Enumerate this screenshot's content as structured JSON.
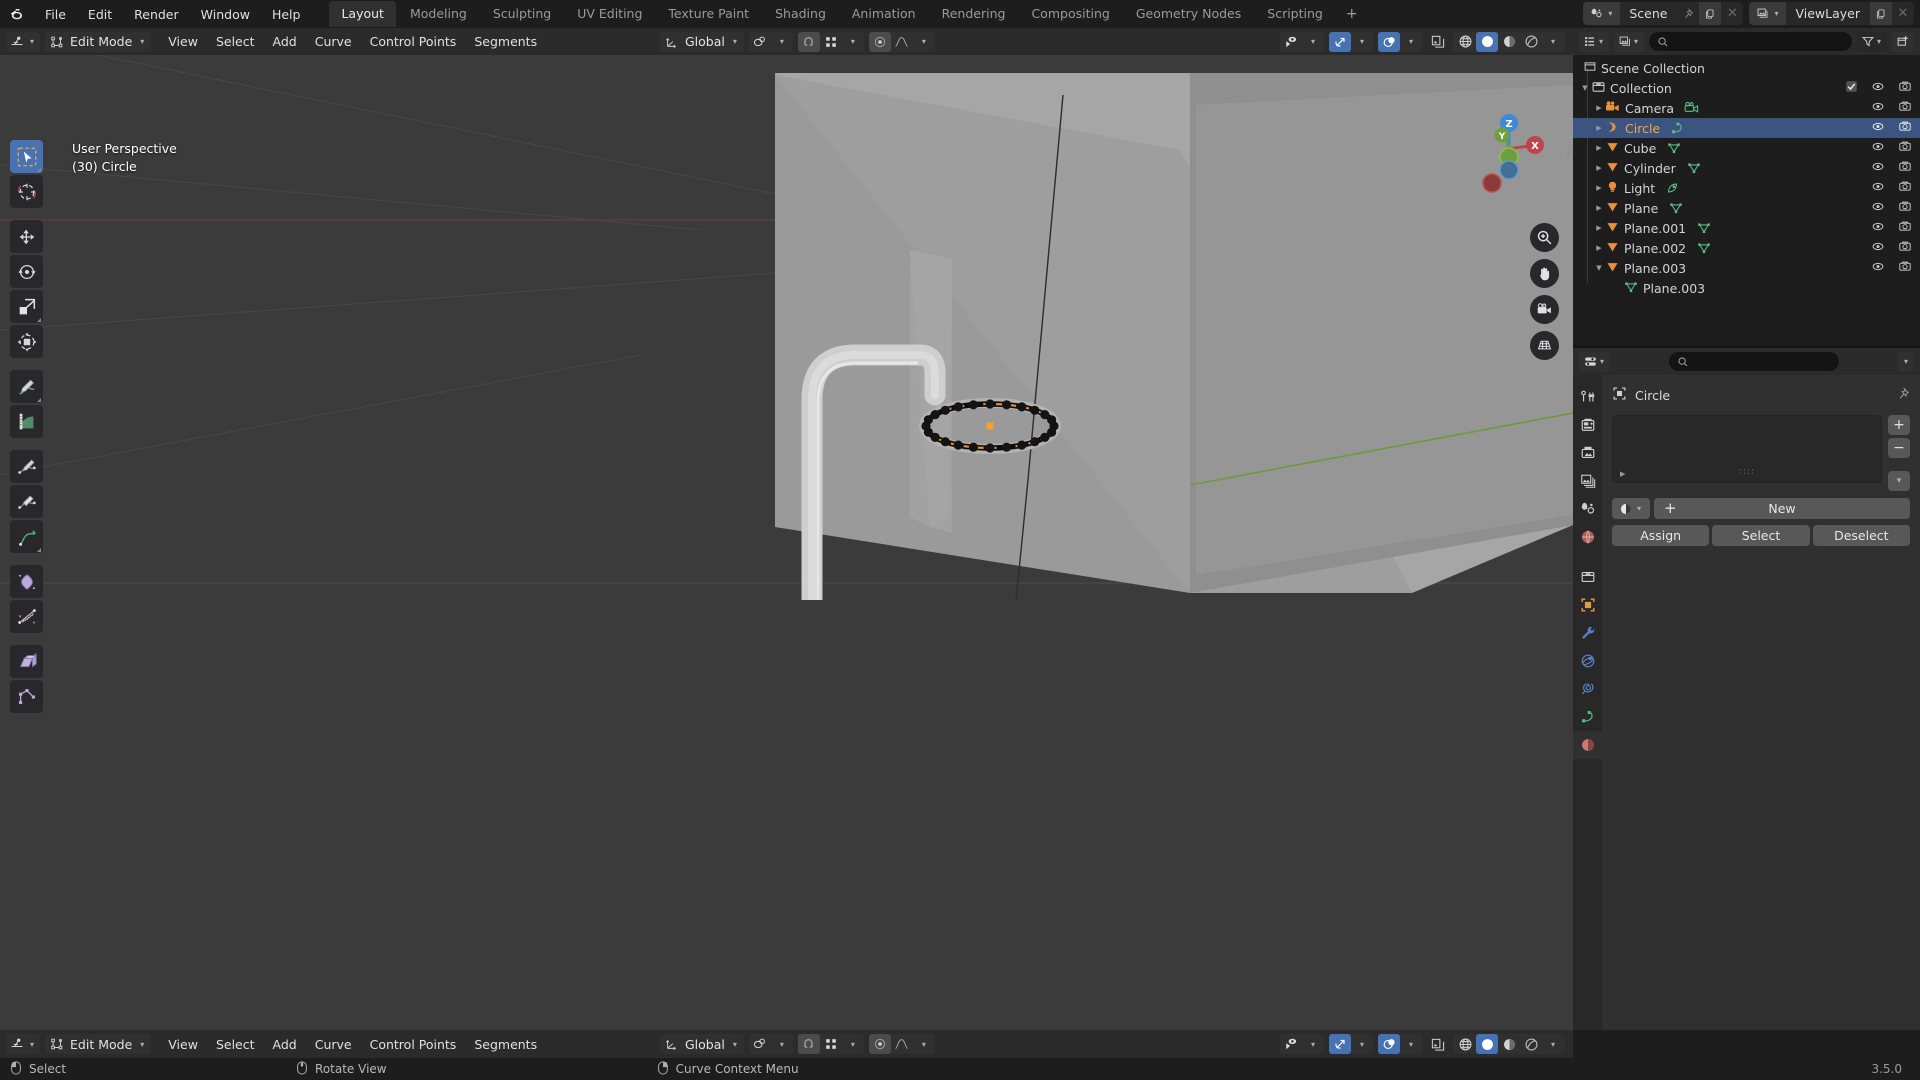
{
  "app": {
    "name": "Blender",
    "version": "3.5.0"
  },
  "topbar": {
    "menus": [
      "File",
      "Edit",
      "Render",
      "Window",
      "Help"
    ],
    "workspace_tabs": [
      {
        "label": "Layout",
        "active": true
      },
      {
        "label": "Modeling",
        "active": false
      },
      {
        "label": "Sculpting",
        "active": false
      },
      {
        "label": "UV Editing",
        "active": false
      },
      {
        "label": "Texture Paint",
        "active": false
      },
      {
        "label": "Shading",
        "active": false
      },
      {
        "label": "Animation",
        "active": false
      },
      {
        "label": "Rendering",
        "active": false
      },
      {
        "label": "Compositing",
        "active": false
      },
      {
        "label": "Geometry Nodes",
        "active": false
      },
      {
        "label": "Scripting",
        "active": false
      }
    ],
    "add_workspace_label": "+",
    "scene": {
      "name": "Scene",
      "icon": "scene-icon"
    },
    "view_layer": {
      "name": "ViewLayer",
      "icon": "view-layer-icon"
    }
  },
  "viewport_header": {
    "mode": "Edit Mode",
    "menus": [
      "View",
      "Select",
      "Add",
      "Curve",
      "Control Points",
      "Segments"
    ],
    "transform_orientation": "Global",
    "pivot_icon": "pivot-icon",
    "snap_icon": "magnet-icon",
    "snap_target_icon": "snap-increment-icon",
    "proportional_icon": "proportional-editing-icon",
    "falloff_icon": "smooth-falloff-icon",
    "visibility_icon": "object-types-visibility-icon",
    "gizmo_icon": "gizmo-icon",
    "overlays_icon": "overlays-icon",
    "xray_icon": "toggle-xray-icon",
    "shading_modes": [
      "wireframe",
      "solid",
      "material-preview",
      "rendered"
    ],
    "shading_active": "solid"
  },
  "viewport": {
    "overlay_line1": "User Perspective",
    "overlay_line2": "(30) Circle",
    "gizmo_axes": [
      "Z",
      "X",
      "Y"
    ],
    "nav_buttons": [
      "zoom-icon",
      "pan-hand-icon",
      "camera-view-icon",
      "toggle-orthographic-icon"
    ],
    "toolbar": [
      {
        "name": "tweak-select-box-tool",
        "active": true
      },
      {
        "name": "cursor-tool",
        "active": false
      },
      {
        "name": "move-tool",
        "active": false
      },
      {
        "name": "rotate-tool",
        "active": false
      },
      {
        "name": "scale-tool",
        "active": false
      },
      {
        "name": "transform-tool",
        "active": false
      },
      {
        "name": "annotate-tool",
        "active": false
      },
      {
        "name": "measure-tool",
        "active": false
      },
      {
        "name": "draw-curve-tool",
        "active": false
      },
      {
        "name": "extrude-curve-tool",
        "active": false
      },
      {
        "name": "radius-curve-tool",
        "active": false
      },
      {
        "name": "tilt-tool",
        "active": false
      },
      {
        "name": "randomize-tool",
        "active": false
      },
      {
        "name": "shear-tool",
        "active": false
      },
      {
        "name": "curve-pen-tool",
        "active": false
      }
    ]
  },
  "outliner": {
    "header_icons": [
      "display-mode-icon",
      "filter-scene-icon",
      "search-icon",
      "filter-icon",
      "new-collection-icon"
    ],
    "search_placeholder": "",
    "root": "Scene Collection",
    "collection": "Collection",
    "items": [
      {
        "label": "Camera",
        "icon": "camera-object-icon",
        "data_icon": "camera-data-icon",
        "selected": false,
        "expanded": false,
        "indent": 1
      },
      {
        "label": "Circle",
        "icon": "curve-object-icon",
        "data_icon": "curve-data-icon",
        "selected": true,
        "expanded": false,
        "indent": 1
      },
      {
        "label": "Cube",
        "icon": "mesh-object-icon",
        "data_icon": "mesh-data-icon",
        "selected": false,
        "expanded": false,
        "indent": 1
      },
      {
        "label": "Cylinder",
        "icon": "mesh-object-icon",
        "data_icon": "mesh-data-icon",
        "selected": false,
        "expanded": false,
        "indent": 1
      },
      {
        "label": "Light",
        "icon": "light-object-icon",
        "data_icon": "light-data-icon",
        "selected": false,
        "expanded": false,
        "indent": 1
      },
      {
        "label": "Plane",
        "icon": "mesh-object-icon",
        "data_icon": "mesh-data-icon",
        "selected": false,
        "expanded": false,
        "indent": 1
      },
      {
        "label": "Plane.001",
        "icon": "mesh-object-icon",
        "data_icon": "mesh-data-icon",
        "selected": false,
        "expanded": false,
        "indent": 1
      },
      {
        "label": "Plane.002",
        "icon": "mesh-object-icon",
        "data_icon": "mesh-data-icon",
        "selected": false,
        "expanded": false,
        "indent": 1
      },
      {
        "label": "Plane.003",
        "icon": "mesh-object-icon",
        "data_icon": "mesh-data-icon",
        "selected": false,
        "expanded": true,
        "indent": 1
      },
      {
        "label": "Plane.003",
        "icon": "",
        "data_icon": "mesh-data-icon",
        "selected": false,
        "expanded": null,
        "indent": 2
      }
    ]
  },
  "properties": {
    "editor_icon": "properties-editor-icon",
    "search_placeholder": "",
    "tabs": [
      {
        "name": "tool-tab",
        "selected": false
      },
      {
        "name": "render-tab",
        "selected": false
      },
      {
        "name": "output-tab",
        "selected": false
      },
      {
        "name": "view-layer-tab",
        "selected": false
      },
      {
        "name": "scene-tab",
        "selected": false
      },
      {
        "name": "world-tab",
        "selected": false
      },
      {
        "name": "collection-tab",
        "selected": false
      },
      {
        "name": "object-tab",
        "selected": false
      },
      {
        "name": "modifier-tab",
        "selected": false
      },
      {
        "name": "physics-tab",
        "selected": false
      },
      {
        "name": "constraint-tab",
        "selected": false
      },
      {
        "name": "object-data-tab",
        "selected": false
      },
      {
        "name": "material-tab",
        "selected": true
      }
    ],
    "breadcrumb_object": "Circle",
    "pin_icon": "pin-icon",
    "material_slot_list_empty": true,
    "side_buttons": [
      "add-slot-button",
      "remove-slot-button",
      "slot-specials-button"
    ],
    "browse_material_label": "",
    "new_button": "New",
    "assign_button": "Assign",
    "select_button": "Select",
    "deselect_button": "Deselect"
  },
  "statusbar": {
    "items": [
      {
        "icon": "mouse-left-icon",
        "label": "Select"
      },
      {
        "icon": "mouse-middle-icon",
        "label": "Rotate View"
      },
      {
        "icon": "mouse-right-icon",
        "label": "Curve Context Menu"
      }
    ],
    "version": "3.5.0"
  },
  "colors": {
    "accent_blue": "#4772b3",
    "select_orange": "#ffa13c",
    "outliner_sel_row": "#3b5580",
    "header_bg": "#2b2b2b",
    "viewport_bg": "#3b3b3b",
    "panel_bg": "#303030",
    "dark_bg": "#1d1d1d"
  }
}
